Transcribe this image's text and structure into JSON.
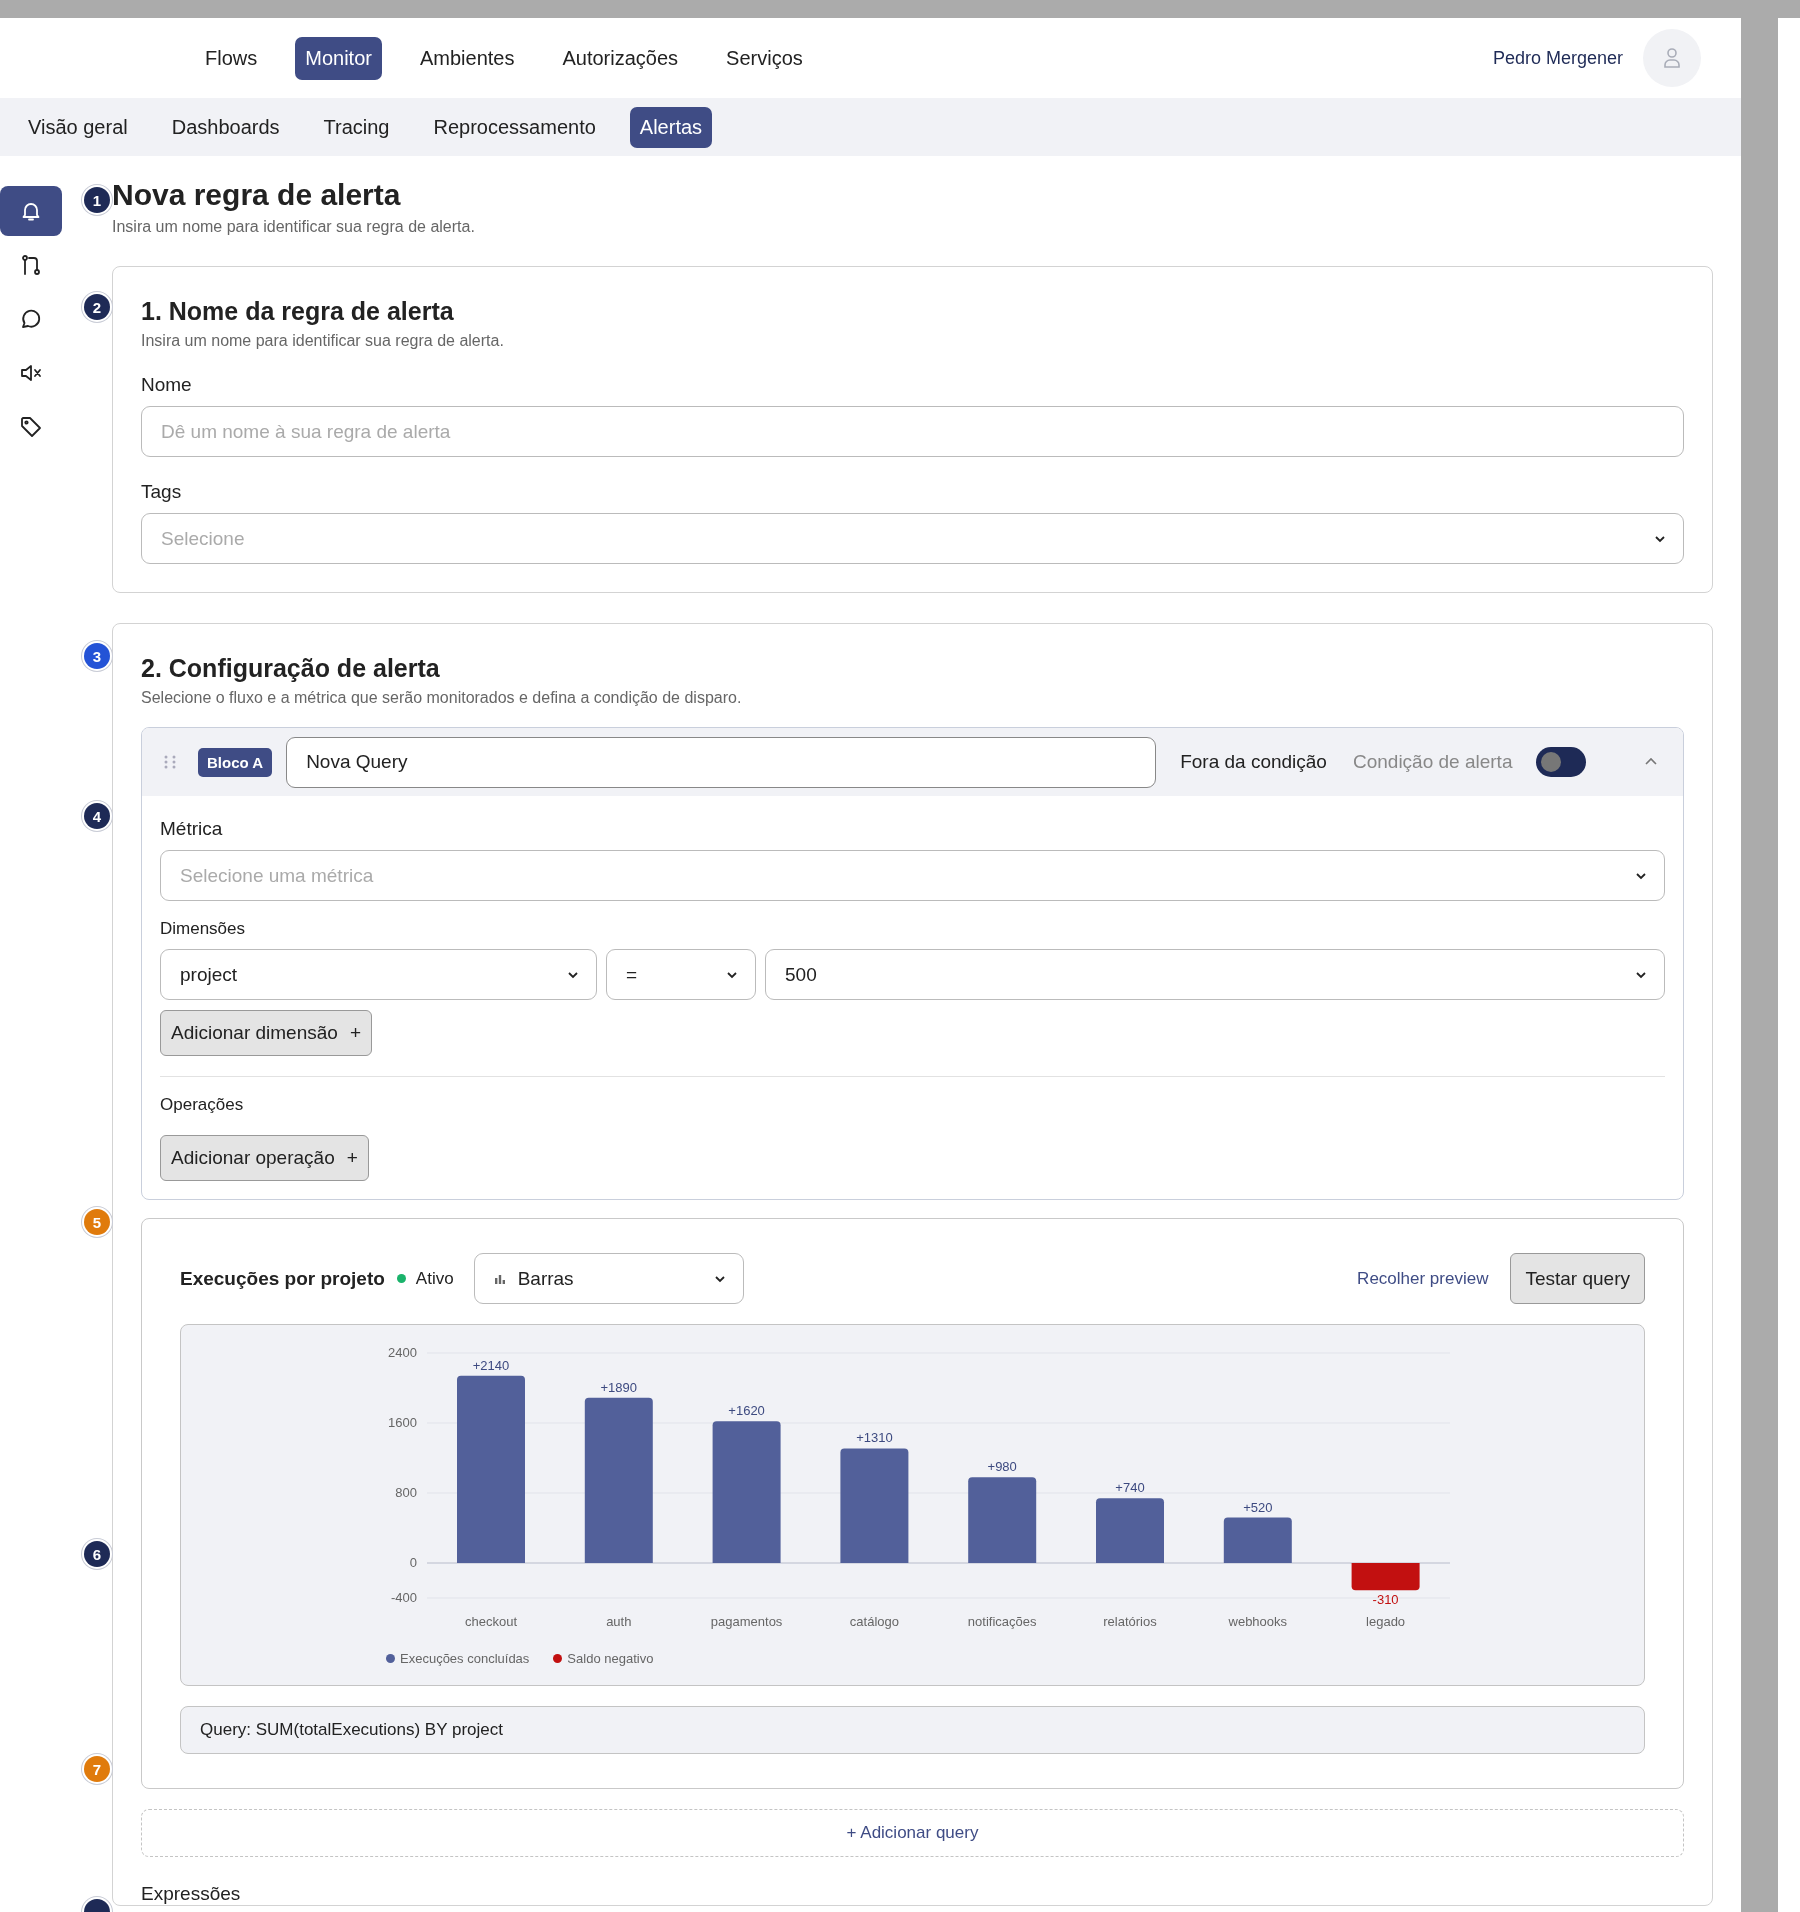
{
  "top_nav": {
    "tabs": [
      {
        "label": "Flows",
        "selected": false
      },
      {
        "label": "Monitor",
        "selected": true
      },
      {
        "label": "Ambientes",
        "selected": false
      },
      {
        "label": "Autorizações",
        "selected": false
      },
      {
        "label": "Serviços",
        "selected": false
      }
    ],
    "user": {
      "name": "Pedro Mergener"
    }
  },
  "sub_nav": {
    "tabs": [
      {
        "label": "Visão geral",
        "selected": false
      },
      {
        "label": "Dashboards",
        "selected": false
      },
      {
        "label": "Tracing",
        "selected": false
      },
      {
        "label": "Reprocessamento",
        "selected": false
      },
      {
        "label": "Alertas",
        "selected": true
      }
    ]
  },
  "sidebar": {
    "items": [
      {
        "kind": "bell",
        "selected": true
      },
      {
        "kind": "branch",
        "selected": false
      },
      {
        "kind": "chat",
        "selected": false
      },
      {
        "kind": "mute",
        "selected": false
      },
      {
        "kind": "tag",
        "selected": false
      }
    ]
  },
  "step_markers": [
    {
      "label": "1",
      "color": "#1e2a56"
    },
    {
      "label": "2",
      "color": "#1e2a56"
    },
    {
      "label": "3",
      "color": "#2453d6"
    },
    {
      "label": "4",
      "color": "#1e2a56"
    },
    {
      "label": "5",
      "color": "#e07b0c"
    },
    {
      "label": "6",
      "color": "#1e2a56"
    },
    {
      "label": "7",
      "color": "#e07b0c"
    },
    {
      "color": "#1e2a56"
    }
  ],
  "page": {
    "title": "Nova regra de alerta",
    "subtitle": "Insira um nome para identificar sua regra de alerta."
  },
  "section_1": {
    "title": "1. Nome da regra de alerta",
    "subtitle": "Insira um nome para identificar sua regra de alerta.",
    "name_field": {
      "label": "Nome",
      "placeholder": "Dê um nome à sua regra de alerta"
    },
    "tags_field": {
      "label": "Tags",
      "placeholder": "Selecione"
    }
  },
  "section_2": {
    "title": "2. Configuração de alerta",
    "subtitle": "Selecione o fluxo e a métrica que serão monitorados e defina a condição de disparo.",
    "block": {
      "badge": "Bloco A",
      "query_name": "Nova Query",
      "state_label": "Fora da condição",
      "toggle": {
        "label": "Condição de alerta",
        "on": false
      },
      "expanded": true,
      "metric": {
        "label": "Métrica",
        "placeholder": "Selecione uma métrica"
      },
      "dimensions": {
        "label": "Dimensões",
        "key": "project",
        "operator": "=",
        "value": "500",
        "add_button": "Adicionar dimensão",
        "add_symbol": "+"
      },
      "operations": {
        "label": "Operações",
        "add_button": "Adicionar operação",
        "add_symbol": "+"
      }
    },
    "preview": {
      "title": "Execuções por projeto",
      "status": "Ativo",
      "chart_type": "Barras",
      "collapse_link": "Recolher preview",
      "test_button": "Testar query",
      "chart_data": {
        "type": "bar",
        "categories": [
          "checkout",
          "auth",
          "pagamentos",
          "catálogo",
          "notificações",
          "relatórios",
          "webhooks",
          "legado"
        ],
        "series": [
          {
            "name": "Execuções concluídas",
            "color": "#52609a",
            "values": [
              2140,
              1890,
              1620,
              1310,
              980,
              740,
              520,
              null
            ]
          },
          {
            "name": "Saldo negativo",
            "color": "#c21010",
            "values": [
              null,
              null,
              null,
              null,
              null,
              null,
              null,
              -310
            ]
          }
        ],
        "legend": "bottom",
        "ylim": [
          -400,
          2400
        ],
        "yticks": [
          -400,
          0,
          800,
          1600,
          2400
        ],
        "value_labels": [
          "+2140",
          "+1890",
          "+1620",
          "+1310",
          "+980",
          "+740",
          "+520",
          "-310"
        ]
      },
      "query": "Query: SUM(totalExecutions) BY project"
    },
    "add_query": "+ Adicionar query",
    "expressions_label": "Expressões"
  }
}
